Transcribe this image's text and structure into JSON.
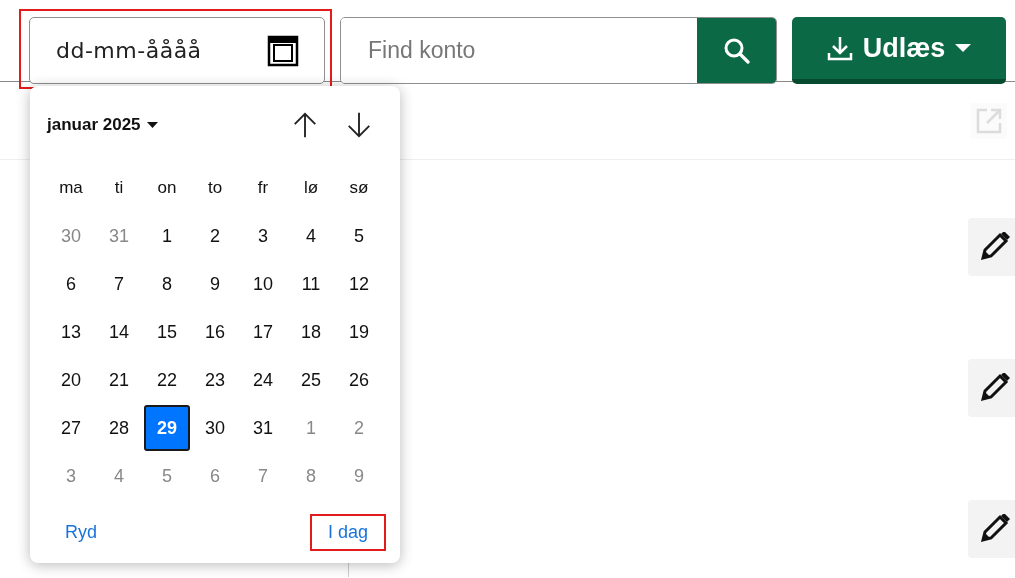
{
  "date_field": {
    "placeholder": "dd-mm-åååå",
    "highlighted": true
  },
  "search": {
    "placeholder": "Find konto"
  },
  "export_button": {
    "label": "Udlæs"
  },
  "calendar": {
    "month_label": "januar 2025",
    "weekdays": [
      "ma",
      "ti",
      "on",
      "to",
      "fr",
      "lø",
      "sø"
    ],
    "weeks": [
      [
        {
          "day": "30",
          "outside": true,
          "selected": false
        },
        {
          "day": "31",
          "outside": true,
          "selected": false
        },
        {
          "day": "1",
          "outside": false,
          "selected": false
        },
        {
          "day": "2",
          "outside": false,
          "selected": false
        },
        {
          "day": "3",
          "outside": false,
          "selected": false
        },
        {
          "day": "4",
          "outside": false,
          "selected": false
        },
        {
          "day": "5",
          "outside": false,
          "selected": false
        }
      ],
      [
        {
          "day": "6",
          "outside": false,
          "selected": false
        },
        {
          "day": "7",
          "outside": false,
          "selected": false
        },
        {
          "day": "8",
          "outside": false,
          "selected": false
        },
        {
          "day": "9",
          "outside": false,
          "selected": false
        },
        {
          "day": "10",
          "outside": false,
          "selected": false
        },
        {
          "day": "11",
          "outside": false,
          "selected": false
        },
        {
          "day": "12",
          "outside": false,
          "selected": false
        }
      ],
      [
        {
          "day": "13",
          "outside": false,
          "selected": false
        },
        {
          "day": "14",
          "outside": false,
          "selected": false
        },
        {
          "day": "15",
          "outside": false,
          "selected": false
        },
        {
          "day": "16",
          "outside": false,
          "selected": false
        },
        {
          "day": "17",
          "outside": false,
          "selected": false
        },
        {
          "day": "18",
          "outside": false,
          "selected": false
        },
        {
          "day": "19",
          "outside": false,
          "selected": false
        }
      ],
      [
        {
          "day": "20",
          "outside": false,
          "selected": false
        },
        {
          "day": "21",
          "outside": false,
          "selected": false
        },
        {
          "day": "22",
          "outside": false,
          "selected": false
        },
        {
          "day": "23",
          "outside": false,
          "selected": false
        },
        {
          "day": "24",
          "outside": false,
          "selected": false
        },
        {
          "day": "25",
          "outside": false,
          "selected": false
        },
        {
          "day": "26",
          "outside": false,
          "selected": false
        }
      ],
      [
        {
          "day": "27",
          "outside": false,
          "selected": false
        },
        {
          "day": "28",
          "outside": false,
          "selected": false
        },
        {
          "day": "29",
          "outside": false,
          "selected": true
        },
        {
          "day": "30",
          "outside": false,
          "selected": false
        },
        {
          "day": "31",
          "outside": false,
          "selected": false
        },
        {
          "day": "1",
          "outside": true,
          "selected": false
        },
        {
          "day": "2",
          "outside": true,
          "selected": false
        }
      ],
      [
        {
          "day": "3",
          "outside": true,
          "selected": false
        },
        {
          "day": "4",
          "outside": true,
          "selected": false
        },
        {
          "day": "5",
          "outside": true,
          "selected": false
        },
        {
          "day": "6",
          "outside": true,
          "selected": false
        },
        {
          "day": "7",
          "outside": true,
          "selected": false
        },
        {
          "day": "8",
          "outside": true,
          "selected": false
        },
        {
          "day": "9",
          "outside": true,
          "selected": false
        }
      ]
    ],
    "clear_label": "Ryd",
    "today": {
      "label": "I dag",
      "highlighted": true
    }
  },
  "rows": [
    {
      "kind": "edit"
    },
    {
      "kind": "edit"
    },
    {
      "kind": "edit"
    }
  ]
}
